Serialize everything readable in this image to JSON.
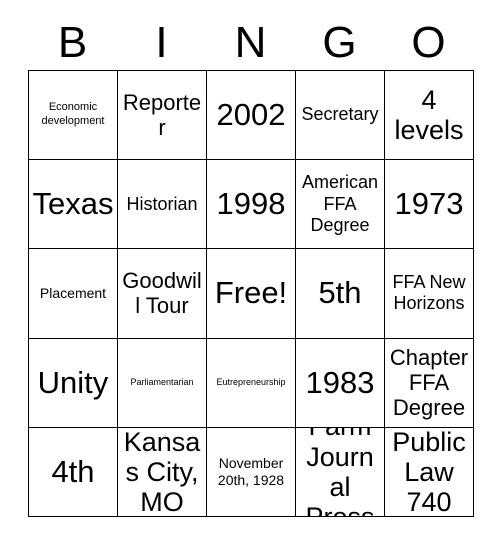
{
  "card": {
    "title": "BINGO Card",
    "background_color": "#ffffff",
    "line_color": "#000000",
    "text_color": "#000000"
  },
  "header": {
    "letters": [
      {
        "label": "B"
      },
      {
        "label": "I"
      },
      {
        "label": "N"
      },
      {
        "label": "G"
      },
      {
        "label": "O"
      }
    ]
  },
  "grid": {
    "rows": 5,
    "columns": 5,
    "cells": [
      {
        "text": "Economic development",
        "size": "xs",
        "free": false
      },
      {
        "text": "Reporter",
        "size": "lg",
        "free": false
      },
      {
        "text": "2002",
        "size": "xxl",
        "free": false
      },
      {
        "text": "Secretary",
        "size": "md",
        "free": false
      },
      {
        "text": "4 levels",
        "size": "xl",
        "free": false
      },
      {
        "text": "Texas",
        "size": "xxl",
        "free": false
      },
      {
        "text": "Historian",
        "size": "md",
        "free": false
      },
      {
        "text": "1998",
        "size": "xxl",
        "free": false
      },
      {
        "text": "American FFA Degree",
        "size": "md",
        "free": false
      },
      {
        "text": "1973",
        "size": "xxl",
        "free": false
      },
      {
        "text": "Placement",
        "size": "sm",
        "free": false
      },
      {
        "text": "Goodwill Tour",
        "size": "lg",
        "free": false
      },
      {
        "text": "Free!",
        "size": "xxl",
        "free": true
      },
      {
        "text": "5th",
        "size": "xxl",
        "free": false
      },
      {
        "text": "FFA New Horizons",
        "size": "md",
        "free": false
      },
      {
        "text": "Unity",
        "size": "xxl",
        "free": false
      },
      {
        "text": "Parliamentarian",
        "size": "xxs",
        "free": false
      },
      {
        "text": "Eutrepreneurship",
        "size": "xxs",
        "free": false
      },
      {
        "text": "1983",
        "size": "xxl",
        "free": false
      },
      {
        "text": "Chapter FFA Degree",
        "size": "lg",
        "free": false
      },
      {
        "text": "4th",
        "size": "xxl",
        "free": false
      },
      {
        "text": "Kansas City, MO",
        "size": "xl",
        "free": false
      },
      {
        "text": "November 20th, 1928",
        "size": "sm",
        "free": false
      },
      {
        "text": "Farm Journal Press",
        "size": "xl",
        "free": false
      },
      {
        "text": "Public Law 740",
        "size": "xl",
        "free": false
      }
    ]
  }
}
